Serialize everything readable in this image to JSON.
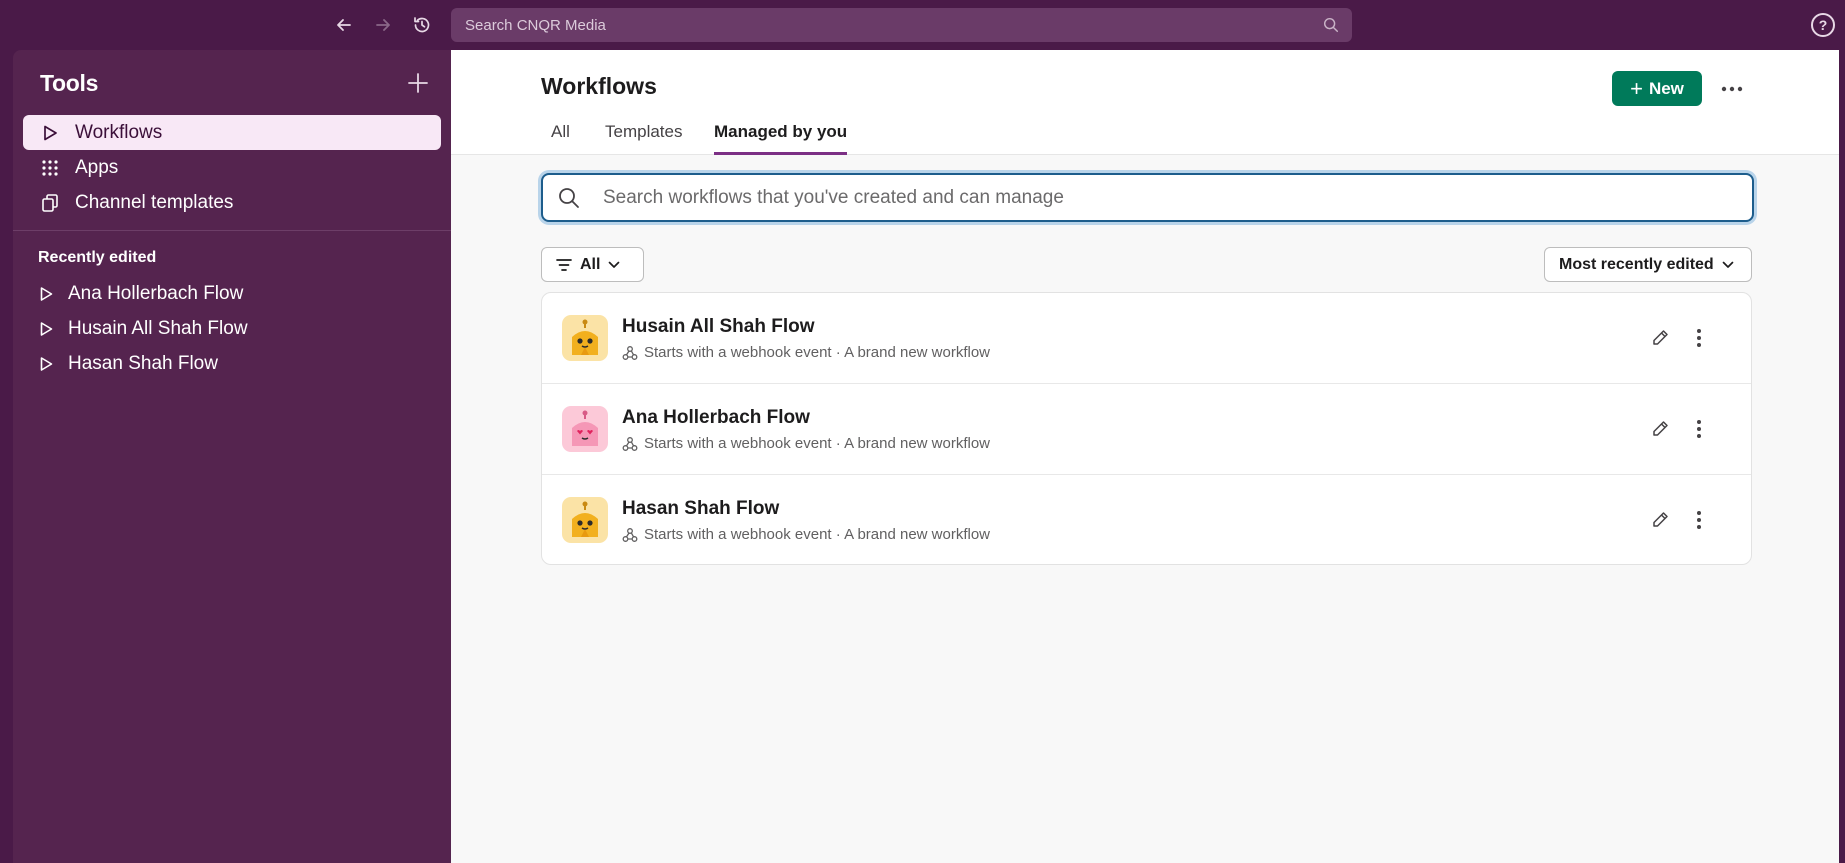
{
  "topbar": {
    "search_placeholder": "Search CNQR Media",
    "help_label": "?"
  },
  "sidebar": {
    "title": "Tools",
    "items": [
      {
        "label": "Workflows",
        "icon": "play-outline-icon",
        "active": true
      },
      {
        "label": "Apps",
        "icon": "grid-dots-icon",
        "active": false
      },
      {
        "label": "Channel templates",
        "icon": "copy-icon",
        "active": false
      }
    ],
    "recent_heading": "Recently edited",
    "recent": [
      {
        "label": "Ana Hollerbach Flow"
      },
      {
        "label": "Husain All Shah Flow"
      },
      {
        "label": "Hasan Shah Flow"
      }
    ]
  },
  "main": {
    "title": "Workflows",
    "new_label": "New",
    "tabs": [
      {
        "label": "All",
        "active": false
      },
      {
        "label": "Templates",
        "active": false
      },
      {
        "label": "Managed by you",
        "active": true
      }
    ],
    "search_placeholder": "Search workflows that you've created and can manage",
    "filter_label": "All",
    "sort_label": "Most recently edited",
    "workflows": [
      {
        "name": "Husain All Shah Flow",
        "subtitle": "Starts with a webhook event · A brand new workflow",
        "avatar": "yellow-robot-icon"
      },
      {
        "name": "Ana Hollerbach Flow",
        "subtitle": "Starts with a webhook event · A brand new workflow",
        "avatar": "pink-robot-icon"
      },
      {
        "name": "Hasan Shah Flow",
        "subtitle": "Starts with a webhook event · A brand new workflow",
        "avatar": "yellow-robot-icon"
      }
    ]
  },
  "colors": {
    "aubergine": "#4a1a48",
    "sidebar": "#55244f",
    "accent_green": "#007a5a",
    "tab_underline": "#7c3085"
  }
}
